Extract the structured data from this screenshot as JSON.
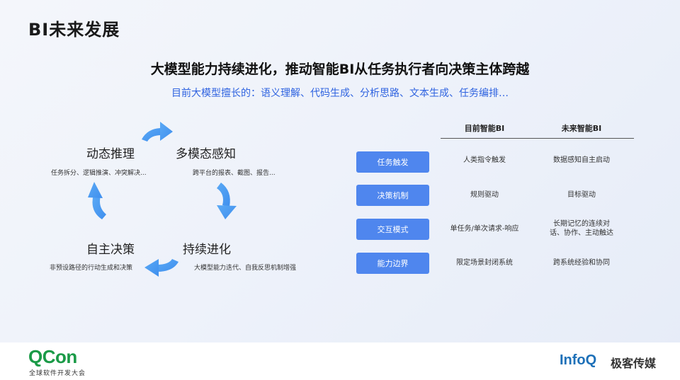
{
  "slide": {
    "title": "BI未来发展",
    "headline": "大模型能力持续进化，推动智能BI从任务执行者向决策主体跨越",
    "subline": "目前大模型擅长的：语义理解、代码生成、分析思路、文本生成、任务编排…"
  },
  "cycle": {
    "arrow_color": "#4d9ef2",
    "nodes": [
      {
        "title": "动态推理",
        "desc": "任务拆分、逻辑推演、冲突解决..."
      },
      {
        "title": "多模态感知",
        "desc": "跨平台的报表、截图、报告..."
      },
      {
        "title": "持续进化",
        "desc": "大模型能力迭代、自我反思机制增强"
      },
      {
        "title": "自主决策",
        "desc": "非预设路径的行动生成和决策"
      }
    ]
  },
  "table": {
    "accent": "#4f86ee",
    "headers": [
      "目前智能BI",
      "未来智能BI"
    ],
    "rows": [
      {
        "label": "任务触发",
        "current": "人类指令触发",
        "future": "数据感知自主启动"
      },
      {
        "label": "决策机制",
        "current": "规则驱动",
        "future": "目标驱动"
      },
      {
        "label": "交互模式",
        "current": "单任务/单次请求-响应",
        "future_l1": "长期记忆的连续对",
        "future_l2": "话、协作、主动触达"
      },
      {
        "label": "能力边界",
        "current": "限定场景封闭系统",
        "future": "跨系统经验和协同"
      }
    ]
  },
  "footer": {
    "qcon_logo": "QCon",
    "qcon_sub": "全球软件开发大会",
    "infoq_logo": "InfoQ",
    "infoq_cn": "极客传媒"
  }
}
